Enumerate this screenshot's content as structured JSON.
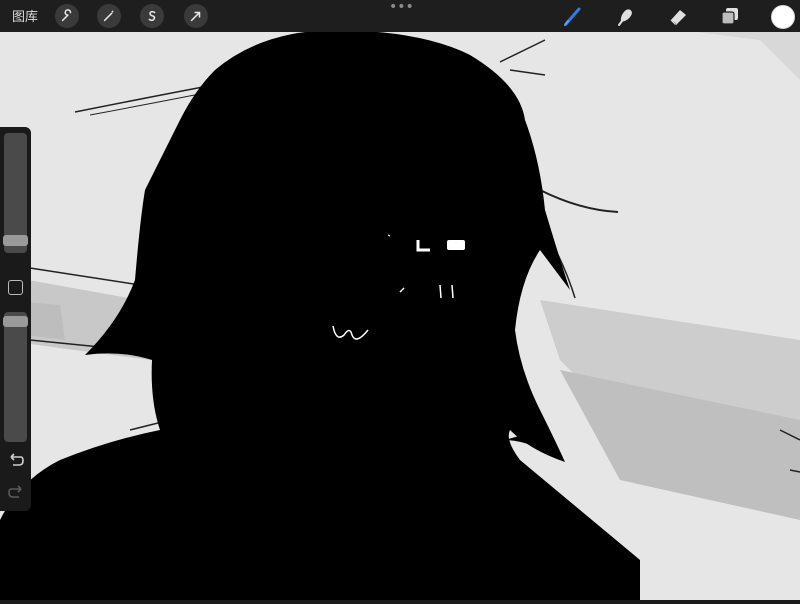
{
  "app": {
    "gallery_label": "图库"
  },
  "toolbar_left": [
    {
      "icon": "wrench-icon"
    },
    {
      "icon": "magic-wand-icon"
    },
    {
      "icon": "selection-s-icon"
    },
    {
      "icon": "transform-arrow-icon"
    }
  ],
  "toolbar_right": [
    {
      "icon": "brush-icon",
      "active_color": "#2f7de1"
    },
    {
      "icon": "smudge-icon"
    },
    {
      "icon": "eraser-icon"
    },
    {
      "icon": "layers-icon"
    }
  ],
  "current_color": "#ffffff",
  "sidebar": {
    "brush_size_level": 0.15,
    "opacity_level": 1.0
  }
}
